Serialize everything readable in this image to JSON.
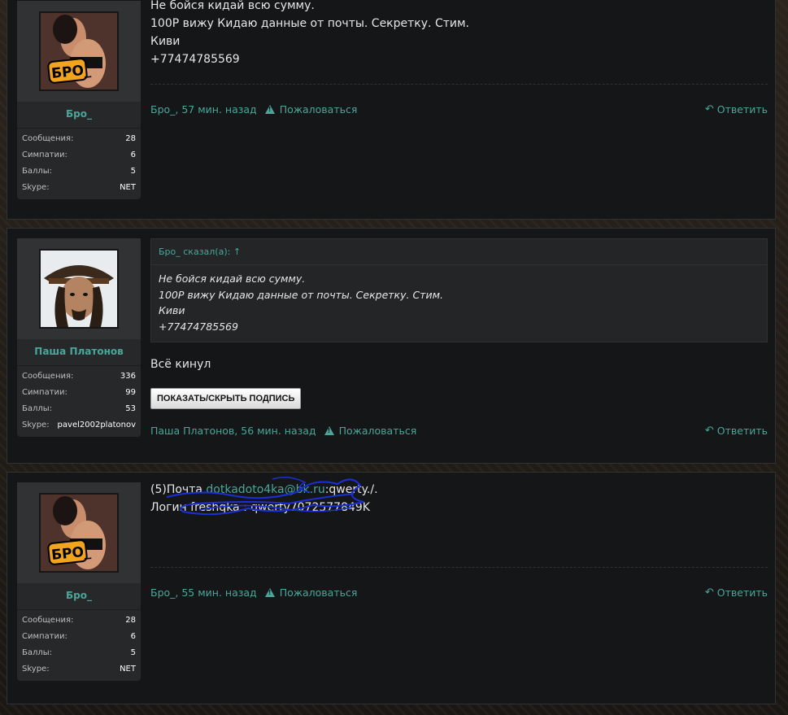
{
  "posts": [
    {
      "username": "Бро_",
      "stats": [
        {
          "label": "Сообщения:",
          "value": "28"
        },
        {
          "label": "Симпатии:",
          "value": "6"
        },
        {
          "label": "Баллы:",
          "value": "5"
        },
        {
          "label": "Skype:",
          "value": "NET"
        }
      ],
      "message": [
        "Не бойся кидай всю сумму.",
        "100Р вижу Кидаю данные от почты. Секретку. Стим.",
        "Киви",
        "+77474785569"
      ],
      "author": "Бро_, 57 мин. назад",
      "report": "Пожаловаться",
      "reply": "Ответить",
      "avatar_caption": "БРО_"
    },
    {
      "username": "Паша Платонов",
      "stats": [
        {
          "label": "Сообщения:",
          "value": "336"
        },
        {
          "label": "Симпатии:",
          "value": "99"
        },
        {
          "label": "Баллы:",
          "value": "53"
        },
        {
          "label": "Skype:",
          "value": "pavel2002platonov"
        }
      ],
      "quote_header": "Бро_ сказал(а): ↑",
      "quote_lines": [
        "Не бойся кидай всю сумму.",
        "100Р вижу Кидаю данные от почты. Секретку. Стим.",
        "Киви",
        "+77474785569"
      ],
      "message": [
        "Всё кинул"
      ],
      "signature_button": "ПОКАЗАТЬ/СКРЫТЬ ПОДПИСЬ",
      "author": "Паша Платонов, 56 мин. назад",
      "report": "Пожаловаться",
      "reply": "Ответить"
    },
    {
      "username": "Бро_",
      "stats": [
        {
          "label": "Сообщения:",
          "value": "28"
        },
        {
          "label": "Симпатии:",
          "value": "6"
        },
        {
          "label": "Баллы:",
          "value": "5"
        },
        {
          "label": "Skype:",
          "value": "NET"
        }
      ],
      "line1_prefix": "(5)Почта ",
      "line1_email": "dotkadoto4ka@bk.ru",
      "line1_suffix": ":qwerty./.",
      "line2": "Логин freshqka : qwerty7072577849K",
      "author": "Бро_, 55 мин. назад",
      "report": "Пожаловаться",
      "reply": "Ответить",
      "avatar_caption": "БРО_"
    }
  ],
  "colors": {
    "accent": "#4aa69a",
    "corner": "#6cbf3a",
    "post_bg": "#151618",
    "scribble": "#1a2fd6"
  },
  "icons": [
    "warning-icon",
    "reply-icon"
  ]
}
